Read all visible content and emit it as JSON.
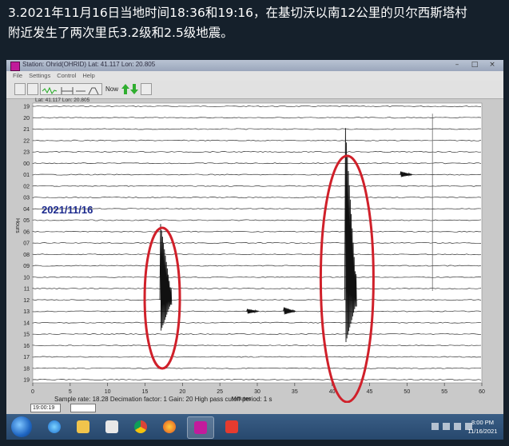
{
  "caption": {
    "line1": "3.2021年11月16日当地时间18:36和19:16，在基切沃以南12公里的贝尔西斯塔村",
    "line2": "附近发生了两次里氏3.2级和2.5级地震。"
  },
  "window": {
    "title": "Station: Ohrid(OHRID) Lat: 41.117 Lon: 20.805",
    "min_label": "–",
    "max_label": "□",
    "close_label": "×"
  },
  "menu": {
    "items": [
      "File",
      "Settings",
      "Control",
      "Help"
    ]
  },
  "toolbar": {
    "now_label": "Now"
  },
  "plot": {
    "latlon": "Lat: 41.117 Lon: 20.805",
    "date_label": "2021/11/16",
    "y_axis_title": "Hours",
    "x_axis_title": "Minutes",
    "hour_labels": [
      "19",
      "20",
      "21",
      "22",
      "23",
      "00",
      "01",
      "02",
      "03",
      "04",
      "05",
      "06",
      "07",
      "08",
      "09",
      "10",
      "11",
      "12",
      "13",
      "14",
      "15",
      "16",
      "17",
      "18",
      "19"
    ],
    "x_ticks": [
      "0",
      "5",
      "10",
      "15",
      "20",
      "25",
      "30",
      "35",
      "40",
      "45",
      "50",
      "55",
      "60"
    ],
    "params": "Sample rate: 18.28  Decimation factor: 1  Gain: 20  High pass cutoff period: 1 s",
    "highlight_color": "#d0202a"
  },
  "statusbar": {
    "time": "19:00:19",
    "field2": ""
  },
  "clock": {
    "time": "8:00 PM",
    "date": "11/16/2021"
  },
  "taskbar_icons": [
    "windows-start-icon",
    "ie-icon",
    "folder-icon",
    "media-player-icon",
    "chrome-icon",
    "firefox-icon",
    "seismograph-app-icon",
    "anydesk-icon"
  ]
}
